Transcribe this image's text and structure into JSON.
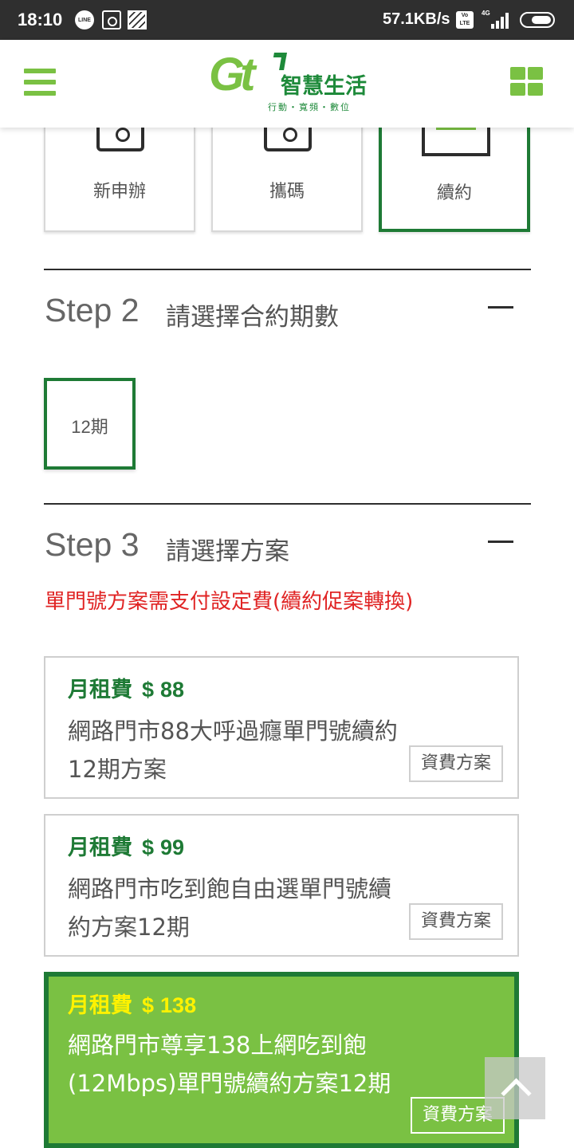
{
  "status_bar": {
    "time": "18:10",
    "line_icon_text": "LINE",
    "network_speed": "57.1KB/s",
    "volte": "Vo LTE",
    "network_type": "4G"
  },
  "header": {
    "logo_text": "Gt",
    "brand_name": "智慧生活",
    "tagline": "行動・寬頻・數位",
    "accent_color": "#7ac143",
    "brand_dark": "#1e7a35"
  },
  "step1": {
    "options": [
      {
        "label": "新申辦",
        "selected": false
      },
      {
        "label": "攜碼",
        "selected": false
      },
      {
        "label": "續約",
        "selected": true
      }
    ]
  },
  "step2": {
    "title": "Step 2",
    "subtitle": "請選擇合約期數",
    "collapse_icon": "minus-icon",
    "period": "12期"
  },
  "step3": {
    "title": "Step 3",
    "subtitle": "請選擇方案",
    "notice": "單門號方案需支付設定費(續約促案轉換)",
    "plans": [
      {
        "price_label": "月租費",
        "currency": "$",
        "amount": "88",
        "name": "網路門市88大呼過癮單門號續約12期方案",
        "tag": "資費方案",
        "selected": false
      },
      {
        "price_label": "月租費",
        "currency": "$",
        "amount": "99",
        "name": "網路門市吃到飽自由選單門號續約方案12期",
        "tag": "資費方案",
        "selected": false
      },
      {
        "price_label": "月租費",
        "currency": "$",
        "amount": "138",
        "name": "網路門市尊享138上網吃到飽(12Mbps)單門號續約方案12期",
        "tag": "資費方案",
        "selected": true
      }
    ]
  }
}
